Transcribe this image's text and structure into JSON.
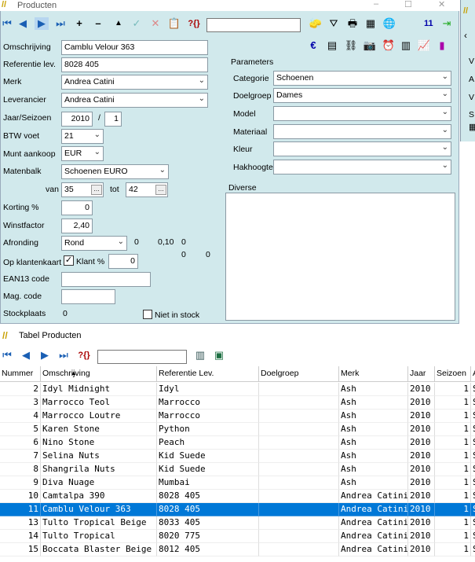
{
  "app": {
    "title": "Producten",
    "count_badge": "11"
  },
  "toolbar": {
    "search_value": "",
    "filter_label": "?{}"
  },
  "form": {
    "omschrijving_label": "Omschrijving",
    "omschrijving_value": "Camblu Velour 363",
    "referentie_label": "Referentie lev.",
    "referentie_value": "8028 405",
    "merk_label": "Merk",
    "merk_value": "Andrea Catini",
    "leverancier_label": "Leverancier",
    "leverancier_value": "Andrea Catini",
    "jaar_label": "Jaar/Seizoen",
    "jaar_value": "2010",
    "slash": "/",
    "seizoen_value": "1",
    "btw_label": "BTW voet",
    "btw_value": "21",
    "munt_label": "Munt aankoop",
    "munt_value": "EUR",
    "matenbalk_label": "Matenbalk",
    "matenbalk_value": "Schoenen EURO",
    "van_label": "van",
    "van_value": "35",
    "tot_label": "tot",
    "tot_value": "42",
    "korting_label": "Korting %",
    "korting_value": "0",
    "winst_label": "Winstfactor",
    "winst_value": "2,40",
    "afronding_label": "Afronding",
    "afronding_value": "Rond",
    "afr_n1": "0",
    "afr_n2": "0,10",
    "afr_n3": "0",
    "afr_n4": "0",
    "afr_n5": "0",
    "klantenkaart_label": "Op klantenkaart",
    "klant_label": "Klant %",
    "klant_value": "0",
    "ean_label": "EAN13 code",
    "ean_value": "",
    "mag_label": "Mag. code",
    "mag_value": "",
    "stock_label": "Stockplaats",
    "stock_value": "0",
    "niet_label": "Niet in stock"
  },
  "params": {
    "title": "Parameters",
    "categorie_label": "Categorie",
    "categorie_value": "Schoenen",
    "doelgroep_label": "Doelgroep",
    "doelgroep_value": "Dames",
    "model_label": "Model",
    "model_value": "",
    "materiaal_label": "Materiaal",
    "materiaal_value": "",
    "kleur_label": "Kleur",
    "kleur_value": "",
    "hakhoogte_label": "Hakhoogte",
    "hakhoogte_value": "",
    "diverse_label": "Diverse"
  },
  "strip": {
    "l1": "V",
    "l2": "A",
    "l3": "V",
    "l4": "S"
  },
  "table": {
    "title": "Tabel Producten",
    "filter_label": "?{}",
    "columns": [
      "Nummer",
      "Omschrijving",
      "Referentie Lev.",
      "Doelgroep",
      "Merk",
      "Jaar",
      "Seizoen",
      "A"
    ],
    "rows": [
      {
        "n": "2",
        "o": "Idyl Midnight",
        "r": "Idyl",
        "d": "",
        "m": "Ash",
        "j": "2010",
        "s": "1",
        "a": "S"
      },
      {
        "n": "3",
        "o": "Marrocco Teol",
        "r": "Marrocco",
        "d": "",
        "m": "Ash",
        "j": "2010",
        "s": "1",
        "a": "S"
      },
      {
        "n": "4",
        "o": "Marrocco Loutre",
        "r": "Marrocco",
        "d": "",
        "m": "Ash",
        "j": "2010",
        "s": "1",
        "a": "S"
      },
      {
        "n": "5",
        "o": "Karen Stone",
        "r": "Python",
        "d": "",
        "m": "Ash",
        "j": "2010",
        "s": "1",
        "a": "S"
      },
      {
        "n": "6",
        "o": "Nino Stone",
        "r": "Peach",
        "d": "",
        "m": "Ash",
        "j": "2010",
        "s": "1",
        "a": "S"
      },
      {
        "n": "7",
        "o": "Selina Nuts",
        "r": "Kid Suede",
        "d": "",
        "m": "Ash",
        "j": "2010",
        "s": "1",
        "a": "S"
      },
      {
        "n": "8",
        "o": "Shangrila Nuts",
        "r": "Kid Suede",
        "d": "",
        "m": "Ash",
        "j": "2010",
        "s": "1",
        "a": "S"
      },
      {
        "n": "9",
        "o": "Diva Nuage",
        "r": "Mumbai",
        "d": "",
        "m": "Ash",
        "j": "2010",
        "s": "1",
        "a": "S"
      },
      {
        "n": "10",
        "o": "Camtalpa 390",
        "r": "8028 405",
        "d": "",
        "m": "Andrea Catini",
        "j": "2010",
        "s": "1",
        "a": "S"
      },
      {
        "n": "11",
        "o": "Camblu Velour 363",
        "r": "8028 405",
        "d": "",
        "m": "Andrea Catini",
        "j": "2010",
        "s": "1",
        "a": "S"
      },
      {
        "n": "13",
        "o": "Tulto Tropical Beige",
        "r": "8033 405",
        "d": "",
        "m": "Andrea Catini",
        "j": "2010",
        "s": "1",
        "a": "S"
      },
      {
        "n": "14",
        "o": "Tulto Tropical",
        "r": "8020 775",
        "d": "",
        "m": "Andrea Catini",
        "j": "2010",
        "s": "1",
        "a": "S"
      },
      {
        "n": "15",
        "o": "Boccata Blaster Beige",
        "r": "8012 405",
        "d": "",
        "m": "Andrea Catini",
        "j": "2010",
        "s": "1",
        "a": "S"
      }
    ],
    "selected_index": 9
  }
}
